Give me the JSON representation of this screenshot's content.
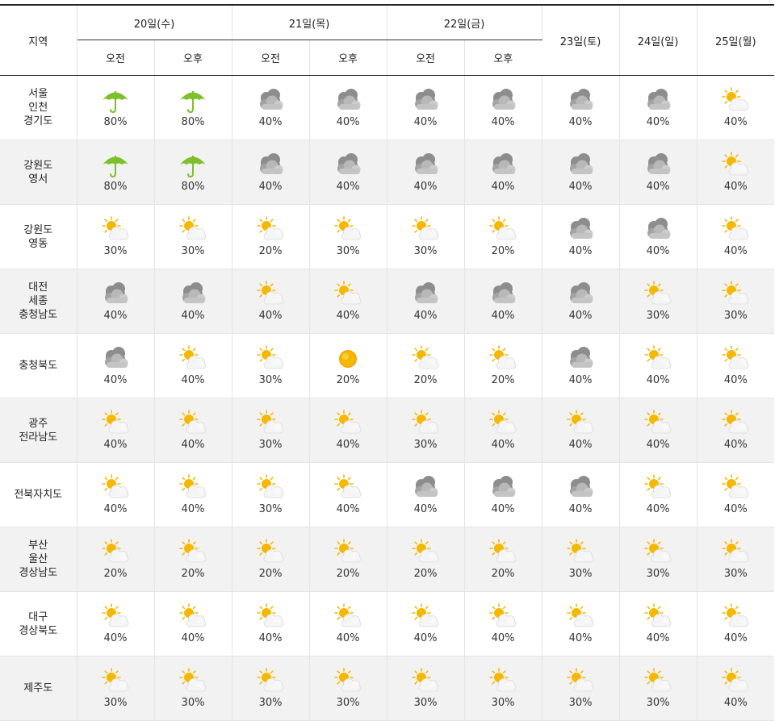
{
  "header": {
    "region_label": "지역",
    "days": [
      {
        "label": "20일(수)",
        "split": true,
        "periods": [
          "오전",
          "오후"
        ]
      },
      {
        "label": "21일(목)",
        "split": true,
        "periods": [
          "오전",
          "오후"
        ]
      },
      {
        "label": "22일(금)",
        "split": true,
        "periods": [
          "오전",
          "오후"
        ]
      },
      {
        "label": "23일(토)",
        "split": false,
        "periods": []
      },
      {
        "label": "24일(일)",
        "split": false,
        "periods": []
      },
      {
        "label": "25일(월)",
        "split": false,
        "periods": []
      }
    ]
  },
  "icon_names": {
    "rain": "umbrella-rain-icon",
    "cloudy": "cloudy-icon",
    "partly": "partly-cloudy-icon",
    "sunny": "sunny-icon"
  },
  "colors": {
    "umbrella": "#7cc02a",
    "sun": "#f5b800",
    "cloud_gray": "#a3a3a3",
    "row_shade": "#f2f2f2"
  },
  "rows": [
    {
      "region": [
        "서울",
        "인천",
        "경기도"
      ],
      "cells": [
        {
          "icon": "rain",
          "pct": "80%"
        },
        {
          "icon": "rain",
          "pct": "80%"
        },
        {
          "icon": "cloudy",
          "pct": "40%"
        },
        {
          "icon": "cloudy",
          "pct": "40%"
        },
        {
          "icon": "cloudy",
          "pct": "40%"
        },
        {
          "icon": "cloudy",
          "pct": "40%"
        },
        {
          "icon": "cloudy",
          "pct": "40%"
        },
        {
          "icon": "cloudy",
          "pct": "40%"
        },
        {
          "icon": "partly",
          "pct": "40%"
        }
      ]
    },
    {
      "region": [
        "강원도",
        "영서"
      ],
      "cells": [
        {
          "icon": "rain",
          "pct": "80%"
        },
        {
          "icon": "rain",
          "pct": "80%"
        },
        {
          "icon": "cloudy",
          "pct": "40%"
        },
        {
          "icon": "cloudy",
          "pct": "40%"
        },
        {
          "icon": "cloudy",
          "pct": "40%"
        },
        {
          "icon": "cloudy",
          "pct": "40%"
        },
        {
          "icon": "cloudy",
          "pct": "40%"
        },
        {
          "icon": "cloudy",
          "pct": "40%"
        },
        {
          "icon": "partly",
          "pct": "40%"
        }
      ]
    },
    {
      "region": [
        "강원도",
        "영동"
      ],
      "cells": [
        {
          "icon": "partly",
          "pct": "30%"
        },
        {
          "icon": "partly",
          "pct": "30%"
        },
        {
          "icon": "partly",
          "pct": "20%"
        },
        {
          "icon": "partly",
          "pct": "30%"
        },
        {
          "icon": "partly",
          "pct": "30%"
        },
        {
          "icon": "partly",
          "pct": "20%"
        },
        {
          "icon": "cloudy",
          "pct": "40%"
        },
        {
          "icon": "cloudy",
          "pct": "40%"
        },
        {
          "icon": "partly",
          "pct": "40%"
        }
      ]
    },
    {
      "region": [
        "대전",
        "세종",
        "충청남도"
      ],
      "cells": [
        {
          "icon": "cloudy",
          "pct": "40%"
        },
        {
          "icon": "cloudy",
          "pct": "40%"
        },
        {
          "icon": "partly",
          "pct": "40%"
        },
        {
          "icon": "partly",
          "pct": "40%"
        },
        {
          "icon": "cloudy",
          "pct": "40%"
        },
        {
          "icon": "cloudy",
          "pct": "40%"
        },
        {
          "icon": "cloudy",
          "pct": "40%"
        },
        {
          "icon": "partly",
          "pct": "30%"
        },
        {
          "icon": "partly",
          "pct": "30%"
        }
      ]
    },
    {
      "region": [
        "충청북도"
      ],
      "cells": [
        {
          "icon": "cloudy",
          "pct": "40%"
        },
        {
          "icon": "partly",
          "pct": "40%"
        },
        {
          "icon": "partly",
          "pct": "30%"
        },
        {
          "icon": "sunny",
          "pct": "20%"
        },
        {
          "icon": "partly",
          "pct": "20%"
        },
        {
          "icon": "partly",
          "pct": "20%"
        },
        {
          "icon": "cloudy",
          "pct": "40%"
        },
        {
          "icon": "partly",
          "pct": "40%"
        },
        {
          "icon": "partly",
          "pct": "40%"
        }
      ]
    },
    {
      "region": [
        "광주",
        "전라남도"
      ],
      "cells": [
        {
          "icon": "partly",
          "pct": "40%"
        },
        {
          "icon": "partly",
          "pct": "40%"
        },
        {
          "icon": "partly",
          "pct": "30%"
        },
        {
          "icon": "partly",
          "pct": "40%"
        },
        {
          "icon": "partly",
          "pct": "30%"
        },
        {
          "icon": "partly",
          "pct": "40%"
        },
        {
          "icon": "partly",
          "pct": "40%"
        },
        {
          "icon": "partly",
          "pct": "40%"
        },
        {
          "icon": "partly",
          "pct": "40%"
        }
      ]
    },
    {
      "region": [
        "전북자치도"
      ],
      "cells": [
        {
          "icon": "partly",
          "pct": "40%"
        },
        {
          "icon": "partly",
          "pct": "40%"
        },
        {
          "icon": "partly",
          "pct": "30%"
        },
        {
          "icon": "partly",
          "pct": "40%"
        },
        {
          "icon": "cloudy",
          "pct": "40%"
        },
        {
          "icon": "cloudy",
          "pct": "40%"
        },
        {
          "icon": "cloudy",
          "pct": "40%"
        },
        {
          "icon": "partly",
          "pct": "40%"
        },
        {
          "icon": "partly",
          "pct": "40%"
        }
      ]
    },
    {
      "region": [
        "부산",
        "울산",
        "경상남도"
      ],
      "cells": [
        {
          "icon": "partly",
          "pct": "20%"
        },
        {
          "icon": "partly",
          "pct": "20%"
        },
        {
          "icon": "partly",
          "pct": "20%"
        },
        {
          "icon": "partly",
          "pct": "20%"
        },
        {
          "icon": "partly",
          "pct": "20%"
        },
        {
          "icon": "partly",
          "pct": "20%"
        },
        {
          "icon": "partly",
          "pct": "30%"
        },
        {
          "icon": "partly",
          "pct": "30%"
        },
        {
          "icon": "partly",
          "pct": "30%"
        }
      ]
    },
    {
      "region": [
        "대구",
        "경상북도"
      ],
      "cells": [
        {
          "icon": "partly",
          "pct": "40%"
        },
        {
          "icon": "partly",
          "pct": "40%"
        },
        {
          "icon": "partly",
          "pct": "40%"
        },
        {
          "icon": "partly",
          "pct": "40%"
        },
        {
          "icon": "partly",
          "pct": "40%"
        },
        {
          "icon": "partly",
          "pct": "40%"
        },
        {
          "icon": "partly",
          "pct": "40%"
        },
        {
          "icon": "partly",
          "pct": "40%"
        },
        {
          "icon": "partly",
          "pct": "40%"
        }
      ]
    },
    {
      "region": [
        "제주도"
      ],
      "cells": [
        {
          "icon": "partly",
          "pct": "30%"
        },
        {
          "icon": "partly",
          "pct": "30%"
        },
        {
          "icon": "partly",
          "pct": "30%"
        },
        {
          "icon": "partly",
          "pct": "30%"
        },
        {
          "icon": "partly",
          "pct": "30%"
        },
        {
          "icon": "partly",
          "pct": "30%"
        },
        {
          "icon": "partly",
          "pct": "30%"
        },
        {
          "icon": "partly",
          "pct": "30%"
        },
        {
          "icon": "partly",
          "pct": "40%"
        }
      ]
    }
  ]
}
